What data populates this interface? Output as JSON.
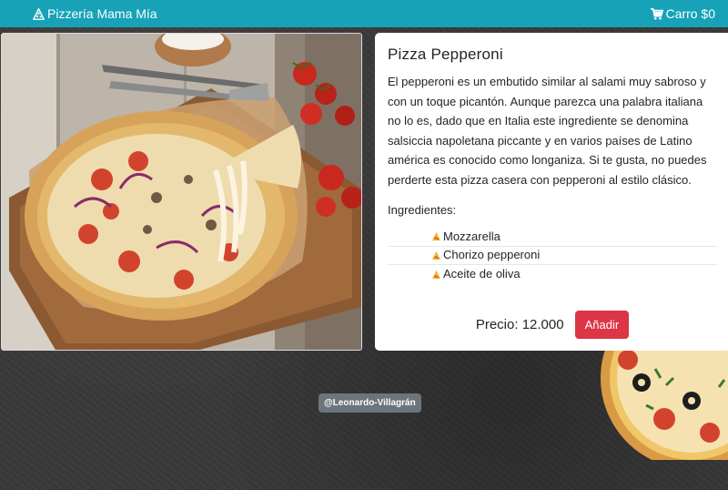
{
  "navbar": {
    "brand": "Pizzería Mama Mía",
    "brand_icon": "pizza-icon",
    "cart_label": "Carro $0",
    "cart_icon": "cart-icon",
    "bg_color": "#17a2b8"
  },
  "product": {
    "image_alt": "pizza-photo",
    "title": "Pizza Pepperoni",
    "description": "El pepperoni es un embutido similar al salami muy sabroso y con un toque picantón. Aunque parezca una palabra italiana no lo es, dado que en Italia este ingrediente se denomina salsiccia napoletana piccante y en varios países de Latino américa es conocido como longaniza. Si te gusta, no puedes perderte esta pizza casera con pepperoni al estilo clásico.",
    "ingredients_label": "Ingredientes:",
    "ingredients": [
      "Mozzarella",
      "Chorizo pepperoni",
      "Aceite de oliva"
    ],
    "ingredient_icon": "pizza-slice-icon",
    "price_label": "Precio: 12.000",
    "add_button": "Añadir",
    "add_button_color": "#dc3545"
  },
  "footer": {
    "credit": "@Leonardo-Villagrán",
    "credit_bg": "#6c757d"
  }
}
